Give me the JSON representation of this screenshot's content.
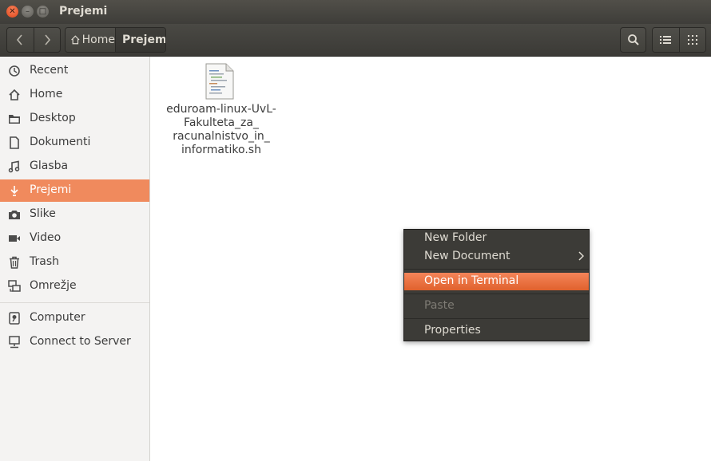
{
  "window": {
    "title": "Prejemi"
  },
  "toolbar": {
    "breadcrumbs": [
      {
        "label": "Home",
        "icon": "home-icon"
      },
      {
        "label": "Prejemi",
        "active": true
      }
    ]
  },
  "sidebar": {
    "items": [
      {
        "label": "Recent",
        "icon": "clock-icon"
      },
      {
        "label": "Home",
        "icon": "home-icon"
      },
      {
        "label": "Desktop",
        "icon": "folder-icon"
      },
      {
        "label": "Dokumenti",
        "icon": "document-icon"
      },
      {
        "label": "Glasba",
        "icon": "music-icon"
      },
      {
        "label": "Prejemi",
        "icon": "download-icon",
        "selected": true
      },
      {
        "label": "Slike",
        "icon": "camera-icon"
      },
      {
        "label": "Video",
        "icon": "video-icon"
      },
      {
        "label": "Trash",
        "icon": "trash-icon"
      },
      {
        "label": "Omrežje",
        "icon": "network-icon"
      },
      {
        "label": "Computer",
        "icon": "computer-icon"
      },
      {
        "label": "Connect to Server",
        "icon": "server-icon"
      }
    ]
  },
  "content": {
    "files": [
      {
        "name": "eduroam-linux-UvL-Fakulteta_za_racunalnistvo_in_informatiko.sh",
        "display_lines": [
          "eduroam-linux-UvL-",
          "Fakulteta_za_",
          "racunalnistvo_in_",
          "informatiko.sh"
        ],
        "icon": "shell-script-icon"
      }
    ]
  },
  "context_menu": {
    "items": [
      {
        "label": "New Folder"
      },
      {
        "label": "New Document",
        "submenu": true
      },
      {
        "label": "Open in Terminal",
        "highlighted": true
      },
      {
        "label": "Paste",
        "disabled": true
      },
      {
        "label": "Properties"
      }
    ]
  },
  "colors": {
    "accent": "#f08a5d",
    "menu_highlight": "#e9683a",
    "header_dark": "#3c3b37"
  }
}
